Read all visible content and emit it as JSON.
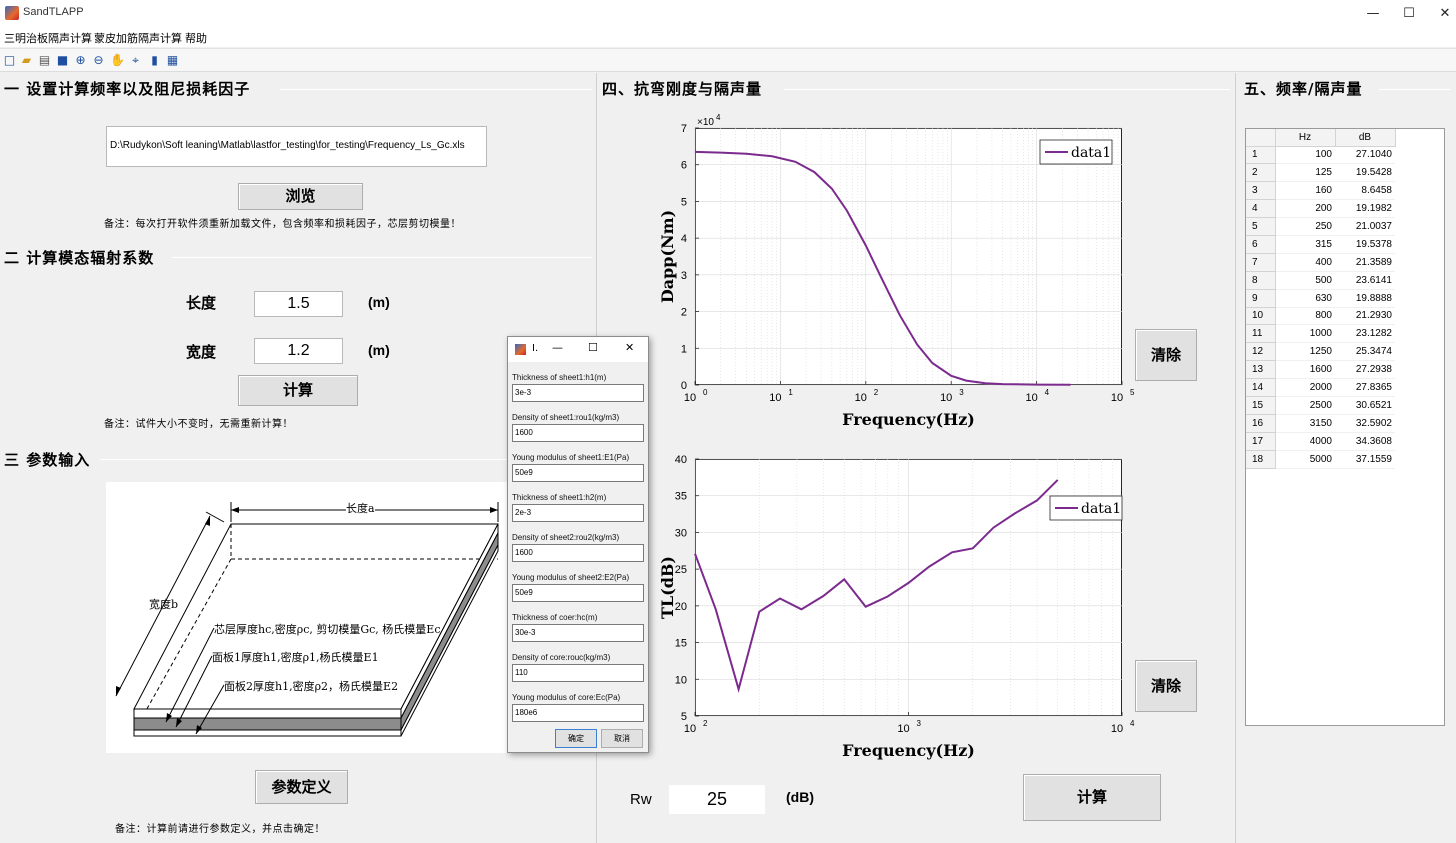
{
  "window": {
    "title": "SandTLAPP",
    "minimize": "—",
    "maximize": "☐",
    "close": "✕"
  },
  "menu": [
    "三明治板隔声计算",
    "蒙皮加筋隔声计算",
    "帮助"
  ],
  "toolbar": {
    "icons": [
      "new-file-icon",
      "open-file-icon",
      "print-icon",
      "save-icon",
      "zoom-in-icon",
      "zoom-out-icon",
      "pan-icon",
      "data-cursor-icon",
      "colorbar-icon",
      "legend-icon"
    ]
  },
  "section1": {
    "title": "一 设置计算频率以及阻尼损耗因子",
    "file_path": "D:\\Rudykon\\Soft leaning\\Matlab\\lastfor_testing\\for_testing\\Frequency_Ls_Gc.xls",
    "browse_label": "浏览",
    "note": "备注：每次打开软件须重新加载文件，包含频率和损耗因子，芯层剪切模量！"
  },
  "section2": {
    "title": "二 计算模态辐射系数",
    "length_label": "长度",
    "length_value": "1.5",
    "width_label": "宽度",
    "width_value": "1.2",
    "unit": "(m)",
    "calc_label": "计算",
    "note": "备注：试件大小不变时，无需重新计算！"
  },
  "section3": {
    "title": "三 参数输入",
    "diagram": {
      "length_label": "长度a",
      "width_label": "宽度b",
      "core_label": "芯层厚度hc,密度ρc, 剪切模量Gc, 杨氏模量Ec",
      "sheet1_label": "面板1厚度h1,密度ρ1,杨氏模量E1",
      "sheet2_label": "面板2厚度h1,密度ρ2，杨氏模量E2"
    },
    "define_label": "参数定义",
    "note": "备注：计算前请进行参数定义，并点击确定！"
  },
  "section4": {
    "title": "四、抗弯刚度与隔声量",
    "clear1_label": "清除",
    "clear2_label": "清除",
    "rw_label": "Rw",
    "rw_value": "25",
    "rw_unit": "(dB)",
    "calc_label": "计算"
  },
  "section5": {
    "title": "五、频率/隔声量",
    "columns": [
      "Hz",
      "dB"
    ],
    "rows": [
      [
        "1",
        "100",
        "27.1040"
      ],
      [
        "2",
        "125",
        "19.5428"
      ],
      [
        "3",
        "160",
        "8.6458"
      ],
      [
        "4",
        "200",
        "19.1982"
      ],
      [
        "5",
        "250",
        "21.0037"
      ],
      [
        "6",
        "315",
        "19.5378"
      ],
      [
        "7",
        "400",
        "21.3589"
      ],
      [
        "8",
        "500",
        "23.6141"
      ],
      [
        "9",
        "630",
        "19.8888"
      ],
      [
        "10",
        "800",
        "21.2930"
      ],
      [
        "11",
        "1000",
        "23.1282"
      ],
      [
        "12",
        "1250",
        "25.3474"
      ],
      [
        "13",
        "1600",
        "27.2938"
      ],
      [
        "14",
        "2000",
        "27.8365"
      ],
      [
        "15",
        "2500",
        "30.6521"
      ],
      [
        "16",
        "3150",
        "32.5902"
      ],
      [
        "17",
        "4000",
        "34.3608"
      ],
      [
        "18",
        "5000",
        "37.1559"
      ]
    ]
  },
  "dialog": {
    "title": "I.",
    "fields": [
      {
        "label": "Thickness of sheet1:h1(m)",
        "value": "3e-3"
      },
      {
        "label": "Density of sheet1:rou1(kg/m3)",
        "value": "1600"
      },
      {
        "label": "Young modulus of sheet1:E1(Pa)",
        "value": "50e9"
      },
      {
        "label": "Thickness of sheet1:h2(m)",
        "value": "2e-3"
      },
      {
        "label": "Density of sheet2:rou2(kg/m3)",
        "value": "1600"
      },
      {
        "label": "Young modulus of sheet2:E2(Pa)",
        "value": "50e9"
      },
      {
        "label": "Thickness of coer:hc(m)",
        "value": "30e-3"
      },
      {
        "label": "Density of core:rouc(kg/m3)",
        "value": "110"
      },
      {
        "label": "Young modulus of core:Ec(Pa)",
        "value": "180e6"
      }
    ],
    "ok_label": "确定",
    "cancel_label": "取消"
  },
  "colors": {
    "line": "#7b2a8e",
    "grid": "#d9d9d9"
  },
  "chart_data": [
    {
      "type": "line",
      "xscale": "log",
      "x": [
        1,
        2,
        4,
        8,
        15,
        25,
        40,
        60,
        100,
        150,
        250,
        400,
        600,
        1000,
        1500,
        2500,
        4000,
        10000,
        25000
      ],
      "series": [
        {
          "name": "data1",
          "values": [
            63500,
            63300,
            63000,
            62300,
            60800,
            58000,
            53500,
            47500,
            38000,
            29500,
            19000,
            11000,
            6000,
            2500,
            1200,
            500,
            250,
            100,
            50
          ]
        }
      ],
      "xlabel": "Frequency(Hz)",
      "ylabel": "Dapp(Nm)",
      "xlim": [
        1,
        100000
      ],
      "ylim": [
        0,
        70000
      ],
      "x_ticks": [
        "10",
        "10",
        "10",
        "10",
        "10",
        "10"
      ],
      "x_tick_exponents": [
        "0",
        "1",
        "2",
        "3",
        "4",
        "5"
      ],
      "y_ticks": [
        "0",
        "1",
        "2",
        "3",
        "4",
        "5",
        "6",
        "7"
      ],
      "y_multiplier": "×10",
      "y_multiplier_exponent": "4",
      "grid": true,
      "legend": "top-right"
    },
    {
      "type": "line",
      "xscale": "log",
      "x": [
        100,
        125,
        160,
        200,
        250,
        315,
        400,
        500,
        630,
        800,
        1000,
        1250,
        1600,
        2000,
        2500,
        3150,
        4000,
        5000
      ],
      "series": [
        {
          "name": "data1",
          "values": [
            27.104,
            19.5428,
            8.6458,
            19.1982,
            21.0037,
            19.5378,
            21.3589,
            23.6141,
            19.8888,
            21.293,
            23.1282,
            25.3474,
            27.2938,
            27.8365,
            30.6521,
            32.5902,
            34.3608,
            37.1559
          ]
        }
      ],
      "xlabel": "Frequency(Hz)",
      "ylabel": "TL(dB)",
      "xlim": [
        100,
        10000
      ],
      "ylim": [
        5,
        40
      ],
      "x_ticks": [
        "10",
        "10",
        "10"
      ],
      "x_tick_exponents": [
        "2",
        "3",
        "4"
      ],
      "y_ticks": [
        "5",
        "10",
        "15",
        "20",
        "25",
        "30",
        "35",
        "40"
      ],
      "grid": true,
      "legend": "top-right"
    }
  ]
}
